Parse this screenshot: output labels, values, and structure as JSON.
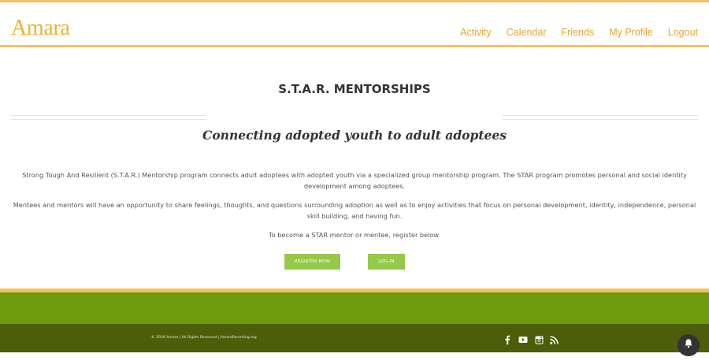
{
  "header": {
    "logo_text": "Amara",
    "nav": [
      {
        "label": "Activity"
      },
      {
        "label": "Calendar"
      },
      {
        "label": "Friends"
      },
      {
        "label": "My Profile"
      },
      {
        "label": "Logout"
      }
    ]
  },
  "main": {
    "title": "S.T.A.R. MENTORSHIPS",
    "subtitle": "Connecting adopted youth to adult adoptees",
    "paragraphs": [
      "Strong Tough And Resilient (S.T.A.R.) Mentorship program connects adult adoptees with adopted youth via a specialized group mentorship program. The STAR program promotes personal and social identity development among adoptees.",
      "Mentees and mentors will have an opportunity to share feelings, thoughts, and questions surrounding adoption as well as to enjoy activities that focus on personal development, identity, independence, personal skill building, and having fun.",
      "To become a STAR mentor or mentee, register below."
    ],
    "register_label": "REGISTER NOW",
    "login_label": "LOG-IN"
  },
  "footer": {
    "copyright": "© 2016 Amara | All Rights Reserved | AmaraParenting.org",
    "social_icons": [
      "facebook-icon",
      "youtube-icon",
      "instagram-icon",
      "rss-icon"
    ]
  },
  "colors": {
    "accent_orange": "#f6c15e",
    "nav_text": "#e9a331",
    "button_green": "#94c94a",
    "footer_green": "#6e9b0c",
    "footer_dark": "#4d5e0a"
  }
}
